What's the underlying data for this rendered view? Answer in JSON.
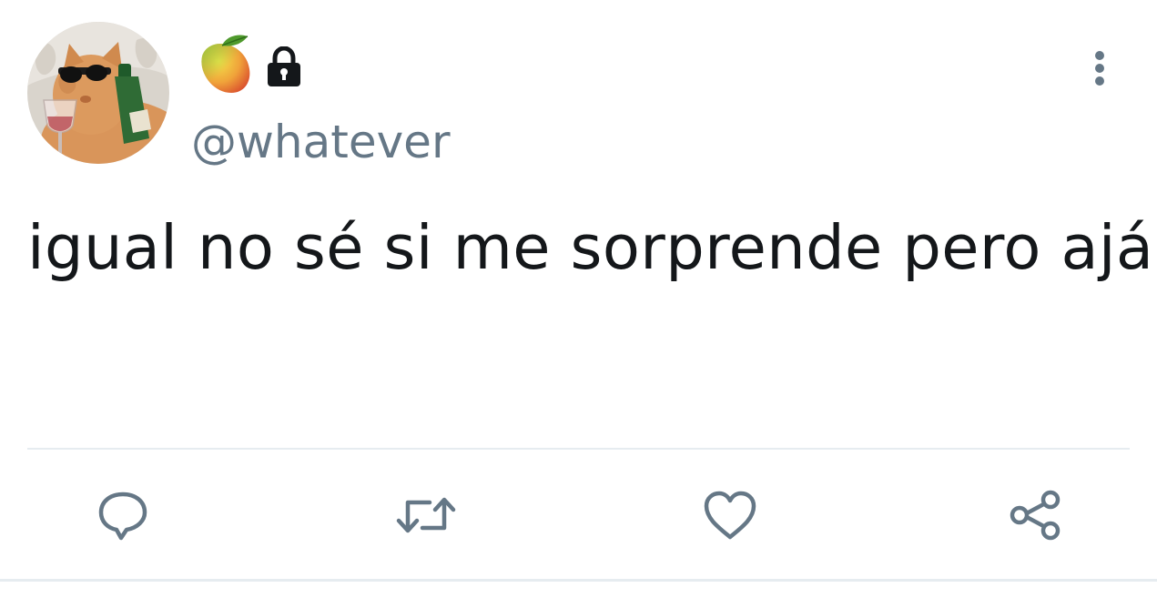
{
  "tweet": {
    "avatar": "profile-photo-cat-with-sunglasses-and-wine",
    "display_name_emoji": "🥭",
    "protected_icon": "lock-icon",
    "handle": "@whatever",
    "text": "igual no sé si me sorprende pero ajá",
    "more_icon": "more-vertical-icon"
  },
  "actions": [
    {
      "name": "reply",
      "icon": "reply-icon"
    },
    {
      "name": "retweet",
      "icon": "retweet-icon"
    },
    {
      "name": "like",
      "icon": "heart-icon"
    },
    {
      "name": "share",
      "icon": "share-icon"
    }
  ],
  "colors": {
    "text": "#14171a",
    "secondary": "#657786",
    "divider": "#e6ecf0",
    "background": "#ffffff"
  }
}
